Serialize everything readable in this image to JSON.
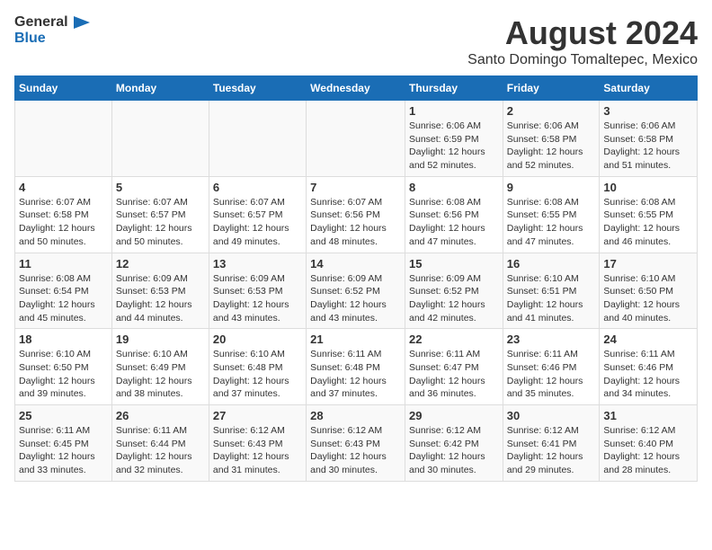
{
  "header": {
    "logo_line1": "General",
    "logo_line2": "Blue",
    "main_title": "August 2024",
    "subtitle": "Santo Domingo Tomaltepec, Mexico"
  },
  "days_of_week": [
    "Sunday",
    "Monday",
    "Tuesday",
    "Wednesday",
    "Thursday",
    "Friday",
    "Saturday"
  ],
  "weeks": [
    [
      {
        "day": "",
        "info": ""
      },
      {
        "day": "",
        "info": ""
      },
      {
        "day": "",
        "info": ""
      },
      {
        "day": "",
        "info": ""
      },
      {
        "day": "1",
        "info": "Sunrise: 6:06 AM\nSunset: 6:59 PM\nDaylight: 12 hours and 52 minutes."
      },
      {
        "day": "2",
        "info": "Sunrise: 6:06 AM\nSunset: 6:58 PM\nDaylight: 12 hours and 52 minutes."
      },
      {
        "day": "3",
        "info": "Sunrise: 6:06 AM\nSunset: 6:58 PM\nDaylight: 12 hours and 51 minutes."
      }
    ],
    [
      {
        "day": "4",
        "info": "Sunrise: 6:07 AM\nSunset: 6:58 PM\nDaylight: 12 hours and 50 minutes."
      },
      {
        "day": "5",
        "info": "Sunrise: 6:07 AM\nSunset: 6:57 PM\nDaylight: 12 hours and 50 minutes."
      },
      {
        "day": "6",
        "info": "Sunrise: 6:07 AM\nSunset: 6:57 PM\nDaylight: 12 hours and 49 minutes."
      },
      {
        "day": "7",
        "info": "Sunrise: 6:07 AM\nSunset: 6:56 PM\nDaylight: 12 hours and 48 minutes."
      },
      {
        "day": "8",
        "info": "Sunrise: 6:08 AM\nSunset: 6:56 PM\nDaylight: 12 hours and 47 minutes."
      },
      {
        "day": "9",
        "info": "Sunrise: 6:08 AM\nSunset: 6:55 PM\nDaylight: 12 hours and 47 minutes."
      },
      {
        "day": "10",
        "info": "Sunrise: 6:08 AM\nSunset: 6:55 PM\nDaylight: 12 hours and 46 minutes."
      }
    ],
    [
      {
        "day": "11",
        "info": "Sunrise: 6:08 AM\nSunset: 6:54 PM\nDaylight: 12 hours and 45 minutes."
      },
      {
        "day": "12",
        "info": "Sunrise: 6:09 AM\nSunset: 6:53 PM\nDaylight: 12 hours and 44 minutes."
      },
      {
        "day": "13",
        "info": "Sunrise: 6:09 AM\nSunset: 6:53 PM\nDaylight: 12 hours and 43 minutes."
      },
      {
        "day": "14",
        "info": "Sunrise: 6:09 AM\nSunset: 6:52 PM\nDaylight: 12 hours and 43 minutes."
      },
      {
        "day": "15",
        "info": "Sunrise: 6:09 AM\nSunset: 6:52 PM\nDaylight: 12 hours and 42 minutes."
      },
      {
        "day": "16",
        "info": "Sunrise: 6:10 AM\nSunset: 6:51 PM\nDaylight: 12 hours and 41 minutes."
      },
      {
        "day": "17",
        "info": "Sunrise: 6:10 AM\nSunset: 6:50 PM\nDaylight: 12 hours and 40 minutes."
      }
    ],
    [
      {
        "day": "18",
        "info": "Sunrise: 6:10 AM\nSunset: 6:50 PM\nDaylight: 12 hours and 39 minutes."
      },
      {
        "day": "19",
        "info": "Sunrise: 6:10 AM\nSunset: 6:49 PM\nDaylight: 12 hours and 38 minutes."
      },
      {
        "day": "20",
        "info": "Sunrise: 6:10 AM\nSunset: 6:48 PM\nDaylight: 12 hours and 37 minutes."
      },
      {
        "day": "21",
        "info": "Sunrise: 6:11 AM\nSunset: 6:48 PM\nDaylight: 12 hours and 37 minutes."
      },
      {
        "day": "22",
        "info": "Sunrise: 6:11 AM\nSunset: 6:47 PM\nDaylight: 12 hours and 36 minutes."
      },
      {
        "day": "23",
        "info": "Sunrise: 6:11 AM\nSunset: 6:46 PM\nDaylight: 12 hours and 35 minutes."
      },
      {
        "day": "24",
        "info": "Sunrise: 6:11 AM\nSunset: 6:46 PM\nDaylight: 12 hours and 34 minutes."
      }
    ],
    [
      {
        "day": "25",
        "info": "Sunrise: 6:11 AM\nSunset: 6:45 PM\nDaylight: 12 hours and 33 minutes."
      },
      {
        "day": "26",
        "info": "Sunrise: 6:11 AM\nSunset: 6:44 PM\nDaylight: 12 hours and 32 minutes."
      },
      {
        "day": "27",
        "info": "Sunrise: 6:12 AM\nSunset: 6:43 PM\nDaylight: 12 hours and 31 minutes."
      },
      {
        "day": "28",
        "info": "Sunrise: 6:12 AM\nSunset: 6:43 PM\nDaylight: 12 hours and 30 minutes."
      },
      {
        "day": "29",
        "info": "Sunrise: 6:12 AM\nSunset: 6:42 PM\nDaylight: 12 hours and 30 minutes."
      },
      {
        "day": "30",
        "info": "Sunrise: 6:12 AM\nSunset: 6:41 PM\nDaylight: 12 hours and 29 minutes."
      },
      {
        "day": "31",
        "info": "Sunrise: 6:12 AM\nSunset: 6:40 PM\nDaylight: 12 hours and 28 minutes."
      }
    ]
  ]
}
